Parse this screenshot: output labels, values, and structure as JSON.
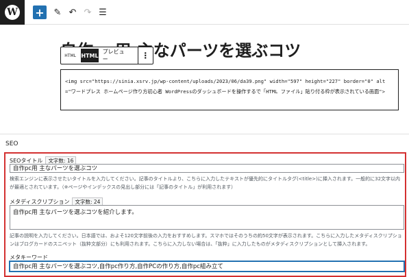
{
  "topbar": {
    "logo_letter": "W",
    "add_icon": "+",
    "edit_icon": "✎",
    "undo_icon": "↶",
    "redo_icon": "↷",
    "list_icon": "☰"
  },
  "editor": {
    "post_title": "自作pc用 主なパーツを選ぶコツ",
    "block_toolbar": {
      "html_small": "HTML",
      "html_active": "HTML",
      "preview": "プレビュー",
      "more": "⋮"
    },
    "code": "<img src=\"https://sinia.xsrv.jp/wp-content/uploads/2023/06/da39.png\" width=\"597\" height=\"227\" border=\"0\" alt=\"ワードプレス ホームページ作り方初心者 WordPressのダッシュボードを操作するで「HTML ファイル」貼り付る枠が表示されている画面\">"
  },
  "seo": {
    "heading": "SEO",
    "title_field": {
      "label": "SEOタイトル",
      "count": "文字数: 16",
      "value": "自作pc用 主なパーツを選ぶコツ",
      "help": "検索エンジンに表示させたいタイトルを入力してください。記事のタイトルより、こちらに入力したテキストが優先的にタイトルタグ(<title>)に挿入されます。一般的に32文字以内が最適とされています。（※ページやインデックスの見出し部分には「記事のタイトル」が利用されます）"
    },
    "description_field": {
      "label": "メタディスクリプション",
      "count": "文字数: 24",
      "value": "自作pc用 主なパーツを選ぶコツを紹介します。",
      "help": "記事の説明を入力してください。日本語では、およそ120文字前後の入力をおすすめします。スマホではそのうちの約50文字が表示されます。こちらに入力したメタディスクリプションはブログカードのスニペット（抜粋文部分）にも利用されます。こちらに入力しない場合は、「抜粋」に入力したものがメタディスクリプションとして挿入されます。"
    },
    "keyword_field": {
      "label": "メタキーワード",
      "value": "自作pc用 主なパーツを選ぶコツ,自作pc作り方,自作PCの作り方,自作pc組み立て"
    }
  },
  "colors": {
    "highlight_border": "#d32f2f",
    "accent": "#2271b1"
  }
}
